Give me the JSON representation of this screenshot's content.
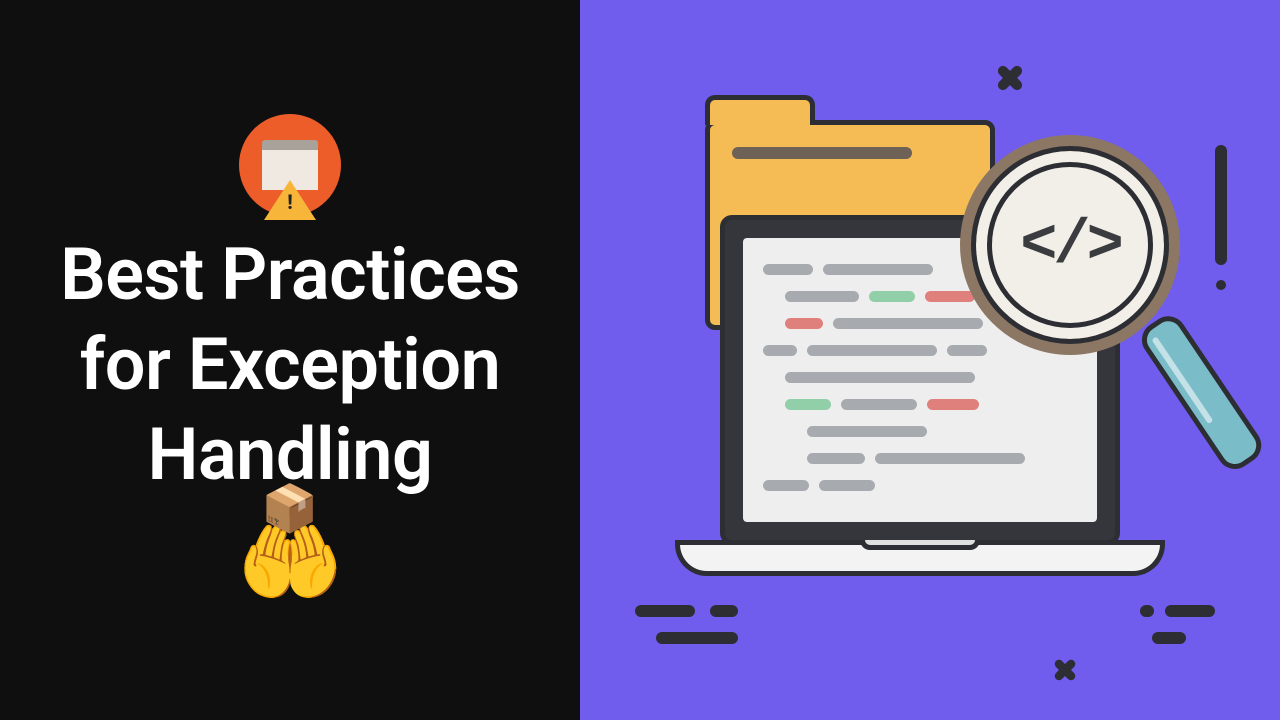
{
  "title": "Best Practices for Exception Handling",
  "icons": {
    "hands_with_box": "🤲📦",
    "code_glyph": "</>"
  },
  "colors": {
    "left_bg": "#0f0f0f",
    "right_bg": "#705CED",
    "accent_orange": "#ed5d2a",
    "folder": "#f5bb55",
    "magnifier_rim": "#8c7764",
    "magnifier_handle": "#7bbcc9"
  }
}
